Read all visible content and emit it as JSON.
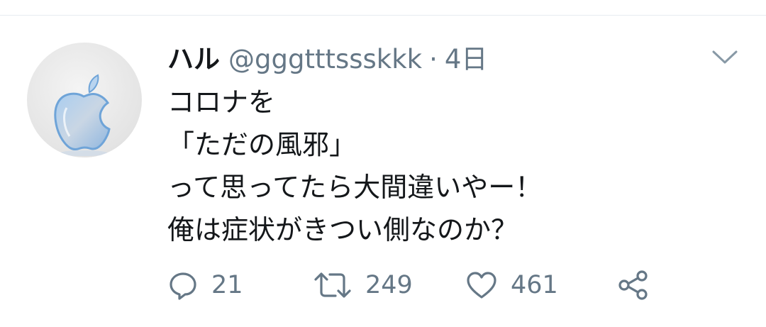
{
  "tweet": {
    "display_name": "ハル",
    "handle": "@gggtttssskkk",
    "separator": "·",
    "time": "4日",
    "text_lines": [
      "コロナを",
      "「ただの風邪」",
      "って思ってたら大間違いやー！",
      "俺は症状がきつい側なのか？"
    ],
    "actions": {
      "reply_count": "21",
      "retweet_count": "249",
      "like_count": "461"
    }
  },
  "icons": {
    "avatar": "apple-logo-avatar",
    "menu": "chevron-down-icon",
    "reply": "reply-icon",
    "retweet": "retweet-icon",
    "like": "heart-icon",
    "share": "share-icon"
  },
  "colors": {
    "text_primary": "#14171a",
    "text_secondary": "#657786",
    "divider": "#e6ecf0",
    "avatar_bg": "#e4e4e4",
    "apple_blue": "#6fa4d8"
  }
}
